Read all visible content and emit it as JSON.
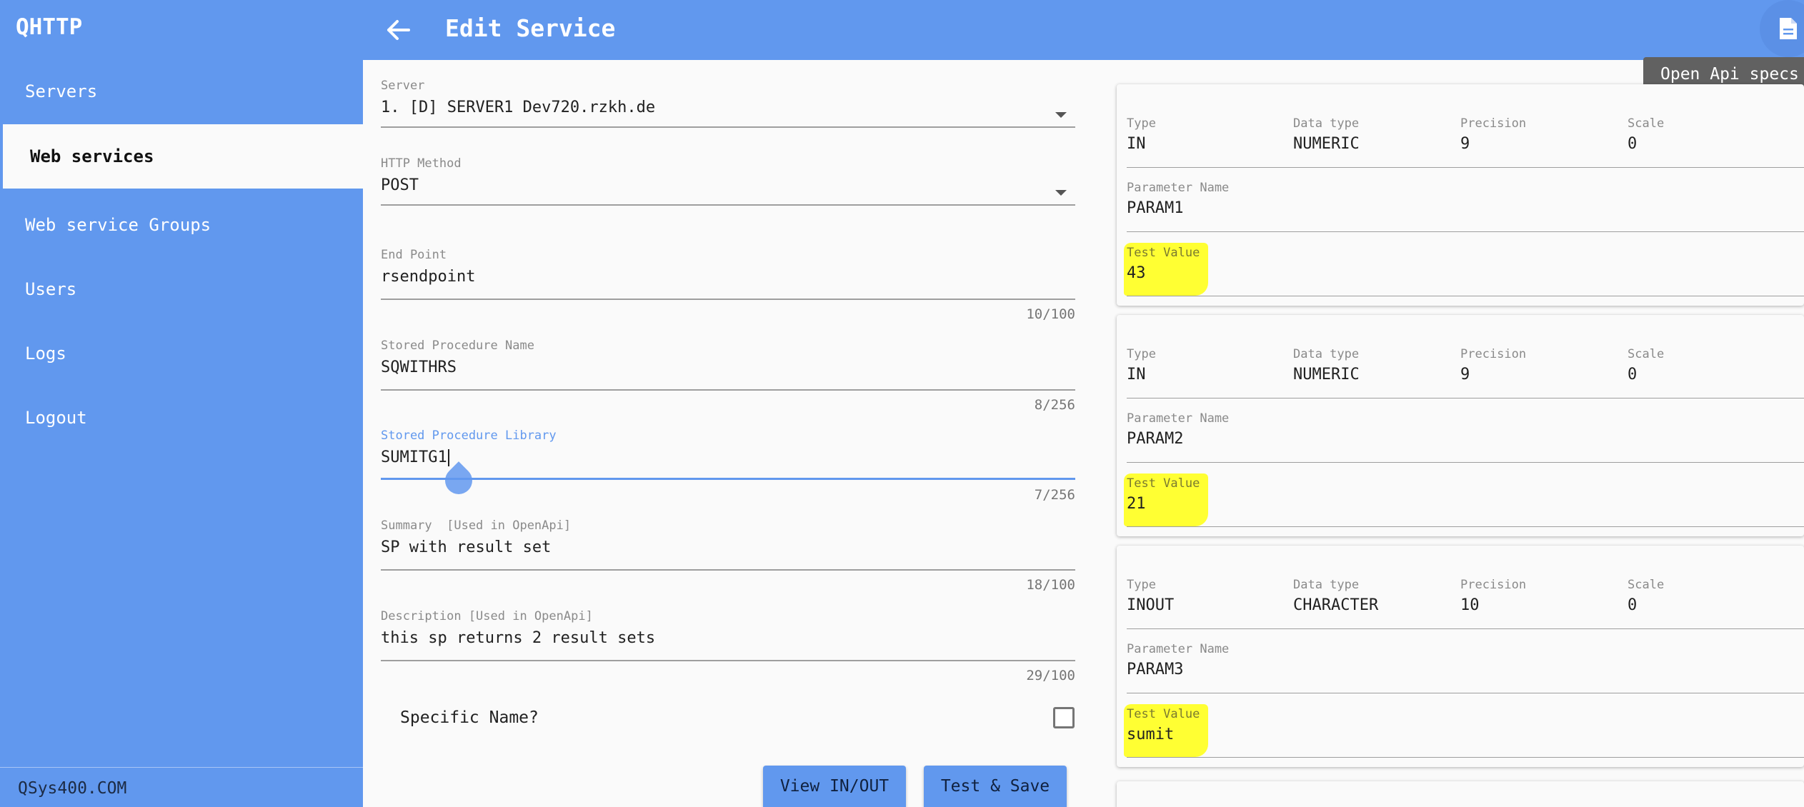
{
  "app": {
    "title": "QHTTP",
    "footer": "QSys400.COM"
  },
  "sidebar": {
    "items": [
      {
        "label": "Servers"
      },
      {
        "label": "Web services"
      },
      {
        "label": "Web service Groups"
      },
      {
        "label": "Users"
      },
      {
        "label": "Logs"
      },
      {
        "label": "Logout"
      }
    ]
  },
  "header": {
    "title": "Edit Service",
    "back_icon": "arrow-left-icon",
    "doc_icon": "document-icon",
    "tooltip": "Open Api specs"
  },
  "form": {
    "server": {
      "label": "Server",
      "value": "1. [D] SERVER1 Dev720.rzkh.de"
    },
    "http_method": {
      "label": "HTTP Method",
      "value": "POST"
    },
    "end_point": {
      "label": "End Point",
      "value": "rsendpoint",
      "counter": "10/100"
    },
    "sp_name": {
      "label": "Stored Procedure Name",
      "value": "SQWITHRS",
      "counter": "8/256"
    },
    "sp_library": {
      "label": "Stored Procedure Library",
      "value": "SUMITG1",
      "counter": "7/256"
    },
    "summary": {
      "label": "Summary  [Used in OpenApi]",
      "value": "SP with result set",
      "counter": "18/100"
    },
    "description": {
      "label": "Description [Used in OpenApi]",
      "value": "this sp returns 2 result sets",
      "counter": "29/100"
    },
    "specific_name": {
      "label": "Specific Name?",
      "checked": false
    },
    "view_inout_label": "View IN/OUT",
    "test_save_label": "Test & Save"
  },
  "param_labels": {
    "type": "Type",
    "data_type": "Data type",
    "precision": "Precision",
    "scale": "Scale",
    "name": "Parameter Name",
    "test_value": "Test Value"
  },
  "params": [
    {
      "type": "IN",
      "data_type": "NUMERIC",
      "precision": "9",
      "scale": "0",
      "name": "PARAM1",
      "test_value": "43"
    },
    {
      "type": "IN",
      "data_type": "NUMERIC",
      "precision": "9",
      "scale": "0",
      "name": "PARAM2",
      "test_value": "21"
    },
    {
      "type": "INOUT",
      "data_type": "CHARACTER",
      "precision": "10",
      "scale": "0",
      "name": "PARAM3",
      "test_value": "sumit"
    }
  ],
  "colors": {
    "primary": "#6198ee",
    "highlight": "#ffff33",
    "tooltip": "#616161"
  }
}
